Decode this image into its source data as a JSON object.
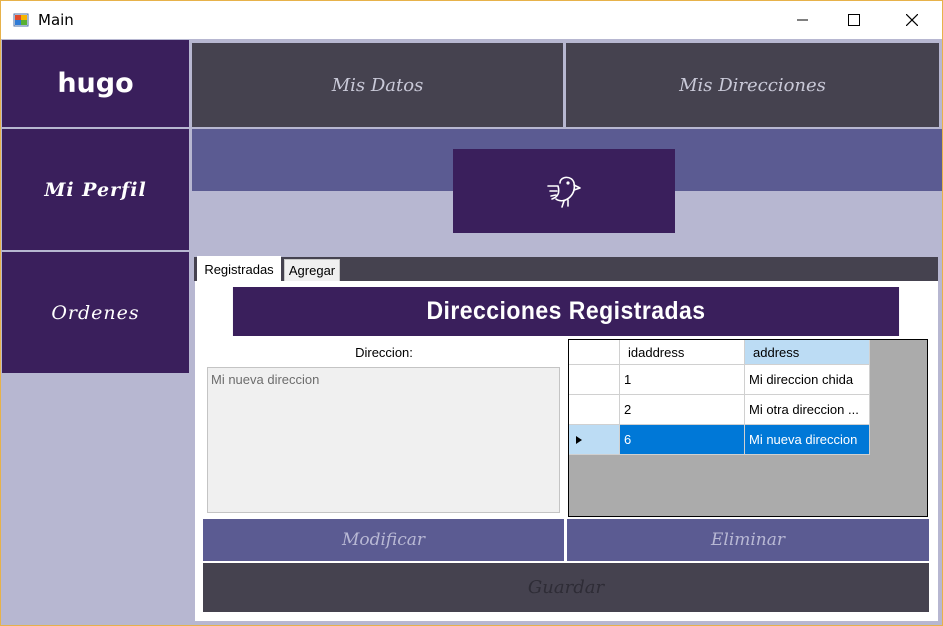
{
  "window": {
    "title": "Main"
  },
  "sidebar": {
    "user": "hugo",
    "perfil": "Mi Perfil",
    "ordenes": "Ordenes"
  },
  "nav": {
    "datos": "Mis Datos",
    "direcciones": "Mis Direcciones"
  },
  "logo": {
    "icon": "bird-icon"
  },
  "tabs": [
    {
      "label": "Registradas"
    },
    {
      "label": "Agregar"
    }
  ],
  "section": {
    "title": "Direcciones Registradas",
    "dir_label": "Direccion:",
    "dir_value": "Mi nueva direccion"
  },
  "grid": {
    "columns": [
      "idaddress",
      "address"
    ],
    "rows": [
      {
        "id": "1",
        "address": "Mi direccion chida"
      },
      {
        "id": "2",
        "address": "Mi otra direccion ..."
      },
      {
        "id": "6",
        "address": "Mi nueva direccion"
      }
    ],
    "selected_row": 2
  },
  "actions": {
    "modificar": "Modificar",
    "eliminar": "Eliminar",
    "guardar": "Guardar"
  },
  "colors": {
    "purple": "#3a1f5c",
    "slate": "#5b5b92",
    "dark": "#45424f",
    "bg": "#b7b7d1",
    "selection": "#0078d7"
  }
}
